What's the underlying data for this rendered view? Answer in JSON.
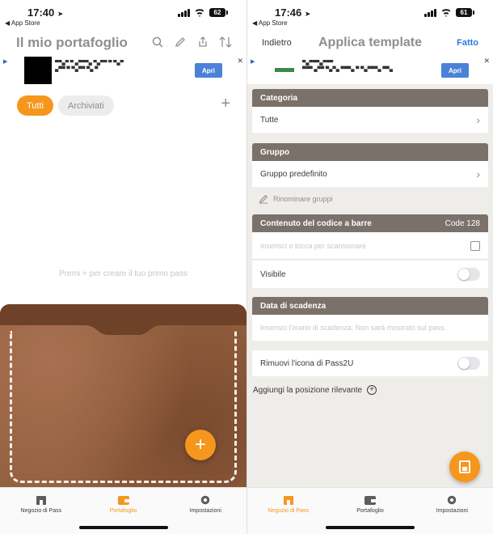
{
  "left": {
    "status": {
      "time": "17:40",
      "back_label": "◀ App Store",
      "battery": "62"
    },
    "header": {
      "title": "Il mio portafoglio"
    },
    "ad": {
      "cta": "Apri",
      "text_line1": "▀▀▄▀ ▀ ▄▀▀▀▄ ▀▄▀▀ ▀ ▀▄▀",
      "text_line2": "▄▀▀ ▀ ▀▄▀▀ ▀▄ ▀"
    },
    "filters": [
      {
        "label": "Tutti"
      },
      {
        "label": "Archiviati"
      }
    ],
    "empty_text": "Premi + per creare il tuo primo pass",
    "tabs": [
      {
        "label": "Negozio di Pass"
      },
      {
        "label": "Portafoglio"
      },
      {
        "label": "Impostazioni"
      }
    ]
  },
  "right": {
    "status": {
      "time": "17:46",
      "back_label": "◀ App Store",
      "battery": "61"
    },
    "nav": {
      "back": "Indietro",
      "title": "Applica template",
      "done": "Fatto"
    },
    "ad": {
      "cta": "Apri",
      "text_line1": "▀▄▀▀▀▄▀▀▀",
      "text_line2": "▀▀▀ ▄▀▀ ▀▄▀▄ ▀▀▀▄ ▀ ▀▄▀▀▀▄ ▀▀▄"
    },
    "category": {
      "header": "Categoria",
      "value": "Tutte"
    },
    "group": {
      "header": "Gruppo",
      "value": "Gruppo predefinito",
      "rename": "Rinominare gruppi"
    },
    "barcode": {
      "header": "Contenuto del codice a barre",
      "type": "Code 128",
      "placeholder": "Inserisci o tocca per scansionare",
      "visible_label": "Visibile"
    },
    "expiry": {
      "header": "Data di scadenza",
      "placeholder": "Inserisci l'orario di scadenza. Non sarà mostrato sul pass."
    },
    "remove_icon": "Rimuovi l'icona di Pass2U",
    "add_location": "Aggiungi la posizione rilevante",
    "tabs": [
      {
        "label": "Negozio di Pass"
      },
      {
        "label": "Portafoglio"
      },
      {
        "label": "Impostazioni"
      }
    ]
  }
}
